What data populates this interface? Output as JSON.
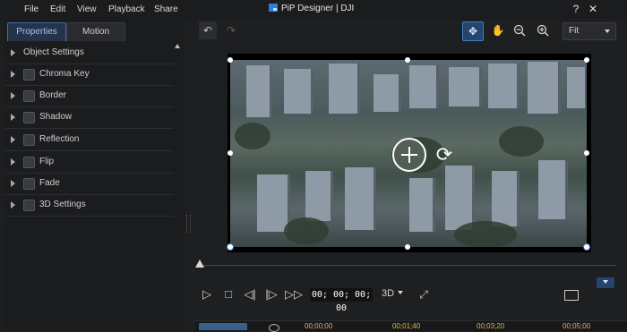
{
  "menu": {
    "file": "File",
    "edit": "Edit",
    "view": "View",
    "playback": "Playback",
    "share": "Share"
  },
  "window": {
    "title": "PiP Designer | DJI",
    "help": "?",
    "close": "✕"
  },
  "tabs": {
    "properties": "Properties",
    "motion": "Motion"
  },
  "properties": [
    {
      "label": "Object Settings",
      "has_checkbox": false
    },
    {
      "label": "Chroma Key",
      "has_checkbox": true
    },
    {
      "label": "Border",
      "has_checkbox": true
    },
    {
      "label": "Shadow",
      "has_checkbox": true
    },
    {
      "label": "Reflection",
      "has_checkbox": true
    },
    {
      "label": "Flip",
      "has_checkbox": true
    },
    {
      "label": "Fade",
      "has_checkbox": true
    },
    {
      "label": "3D Settings",
      "has_checkbox": true
    }
  ],
  "toolbar": {
    "fit_value": "Fit"
  },
  "playback": {
    "timecode": "00; 00; 00; 00",
    "mode_3d": "3D"
  },
  "timeline": {
    "marks": [
      "00;00;00",
      "00;01;40",
      "00;03;20",
      "00;05;00"
    ]
  },
  "colors": {
    "accent": "#3f7fc4",
    "timeline_label": "#e0b64c"
  },
  "icons": {
    "undo": "undo-icon",
    "redo": "redo-icon",
    "move": "move-tool-icon",
    "hand": "hand-icon",
    "zoom_out": "zoom-out-icon",
    "zoom_in": "zoom-in-icon"
  }
}
